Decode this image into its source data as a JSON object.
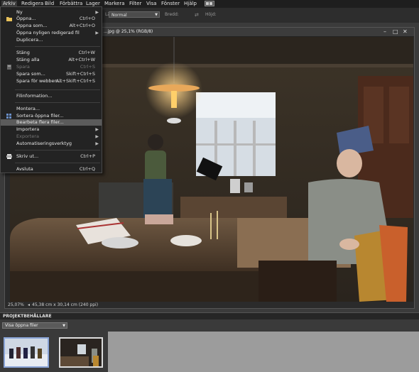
{
  "menubar": {
    "items": [
      "Arkiv",
      "Redigera",
      "Bild",
      "Förbättra",
      "Lager",
      "Markera",
      "Filter",
      "Visa",
      "Fönster",
      "Hjälp"
    ]
  },
  "options_bar": {
    "mode_label": "Läge:",
    "mode_value": "Normal",
    "opacity_label": "Bredd:",
    "height_label": "Höjd:"
  },
  "document": {
    "title": "...jpg @ 25,1% (RGB/8)",
    "status_zoom": "25,07%",
    "status_info": "45,38 cm x 30,14 cm (240 ppi)"
  },
  "file_menu": {
    "items": [
      {
        "label": "Ny",
        "shortcut": "",
        "submenu": true,
        "disabled": false
      },
      {
        "label": "Öppna...",
        "shortcut": "Ctrl+O",
        "submenu": false,
        "disabled": false
      },
      {
        "label": "Öppna som...",
        "shortcut": "Alt+Ctrl+O",
        "submenu": false,
        "disabled": false
      },
      {
        "label": "Öppna nyligen redigerad fil",
        "shortcut": "",
        "submenu": true,
        "disabled": false
      },
      {
        "label": "Duplicera...",
        "shortcut": "",
        "submenu": false,
        "disabled": false
      },
      {
        "label": "Stäng",
        "shortcut": "Ctrl+W",
        "submenu": false,
        "disabled": false
      },
      {
        "label": "Stäng alla",
        "shortcut": "Alt+Ctrl+W",
        "submenu": false,
        "disabled": false
      },
      {
        "label": "Spara",
        "shortcut": "Ctrl+S",
        "submenu": false,
        "disabled": true
      },
      {
        "label": "Spara som...",
        "shortcut": "Skift+Ctrl+S",
        "submenu": false,
        "disabled": false
      },
      {
        "label": "Spara för webben...",
        "shortcut": "Alt+Skift+Ctrl+S",
        "submenu": false,
        "disabled": false
      },
      {
        "label": "Filinformation...",
        "shortcut": "",
        "submenu": false,
        "disabled": false
      },
      {
        "label": "Montera...",
        "shortcut": "",
        "submenu": false,
        "disabled": false
      },
      {
        "label": "Sortera öppna filer...",
        "shortcut": "",
        "submenu": false,
        "disabled": false
      },
      {
        "label": "Bearbeta flera filer...",
        "shortcut": "",
        "submenu": false,
        "disabled": false
      },
      {
        "label": "Importera",
        "shortcut": "",
        "submenu": true,
        "disabled": false
      },
      {
        "label": "Exportera",
        "shortcut": "",
        "submenu": true,
        "disabled": true
      },
      {
        "label": "Automatiseringsverktyg",
        "shortcut": "",
        "submenu": true,
        "disabled": false
      },
      {
        "label": "Skriv ut...",
        "shortcut": "Ctrl+P",
        "submenu": false,
        "disabled": false
      },
      {
        "label": "Avsluta",
        "shortcut": "Ctrl+Q",
        "submenu": false,
        "disabled": false
      }
    ],
    "highlighted_index": 13
  },
  "project_bin": {
    "header": "PROJEKTBEHÅLLARE",
    "dropdown_value": "Visa öppna filer"
  },
  "icons": {
    "folder": "folder-icon",
    "save": "save-icon",
    "organize": "organize-icon",
    "print": "printer-icon",
    "arrange": "arrange-layout-icon"
  },
  "colors": {
    "menu_highlight": "#5b5b5b",
    "menubar_bg": "#1e1e1e",
    "menu_bg": "#232323"
  }
}
